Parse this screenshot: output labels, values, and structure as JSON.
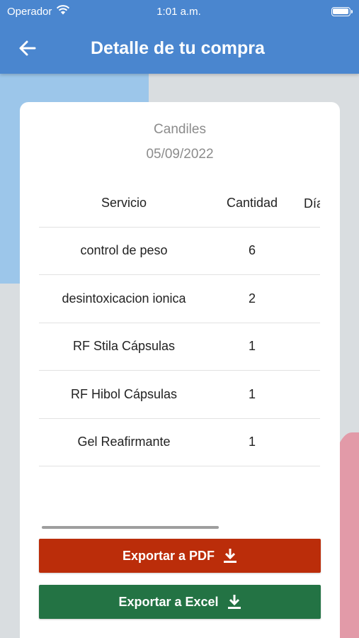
{
  "status_bar": {
    "carrier": "Operador",
    "time": "1:01 a.m."
  },
  "header": {
    "title": "Detalle de tu compra"
  },
  "purchase": {
    "client": "Candiles",
    "date": "05/09/2022"
  },
  "table": {
    "columns": [
      "Servicio",
      "Cantidad",
      "Días vig"
    ],
    "rows": [
      {
        "service": "control de peso",
        "quantity": "6"
      },
      {
        "service": "desintoxicacion ionica",
        "quantity": "2"
      },
      {
        "service": "RF Stila Cápsulas",
        "quantity": "1"
      },
      {
        "service": "RF Hibol Cápsulas",
        "quantity": "1"
      },
      {
        "service": "Gel Reafirmante",
        "quantity": "1"
      }
    ]
  },
  "actions": {
    "pdf_label": "Exportar a PDF",
    "excel_label": "Exportar a Excel"
  },
  "colors": {
    "header": "#4a86cf",
    "pdf_button": "#bb2d0a",
    "excel_button": "#237344"
  }
}
